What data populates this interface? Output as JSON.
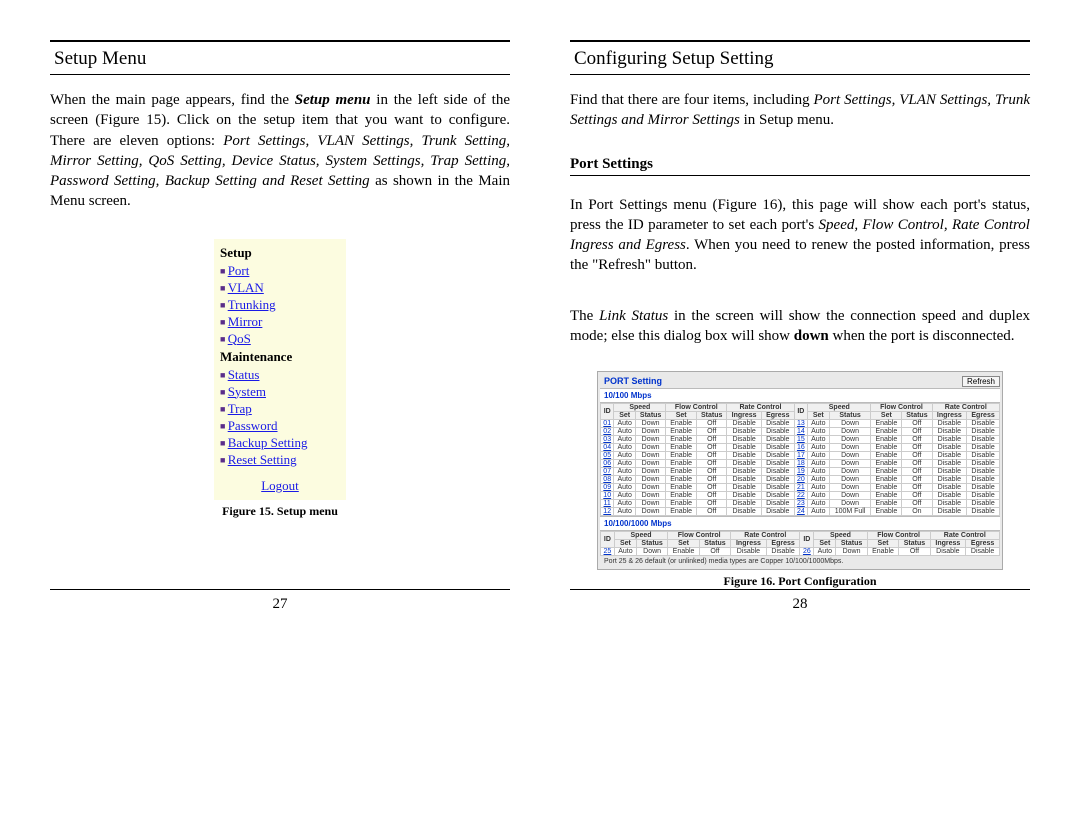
{
  "left": {
    "heading": "Setup Menu",
    "para1_a": "When the main page appears, find the ",
    "para1_b": "Setup menu",
    "para1_c": " in the left side of the screen (Figure 15). Click on the setup item that you want to configure. There are eleven options: ",
    "para1_d": "Port Settings, VLAN Settings, Trunk Setting, Mirror Setting, QoS Setting, Device Status, System Settings, Trap Setting, Password Setting, Backup Setting and Reset Setting",
    "para1_e": " as shown in the Main Menu screen.",
    "menu": {
      "setup": "Setup",
      "items1": [
        "Port",
        "VLAN",
        "Trunking",
        "Mirror",
        "QoS"
      ],
      "maintenance": "Maintenance",
      "items2": [
        "Status",
        "System",
        "Trap",
        "Password",
        "Backup Setting",
        "Reset Setting"
      ],
      "logout": "Logout"
    },
    "caption": "Figure 15. Setup menu",
    "page": "27"
  },
  "right": {
    "heading": "Configuring Setup Setting",
    "para1_a": "Find that there are four items, including ",
    "para1_b": "Port Settings, VLAN Settings, Trunk Settings and Mirror Settings",
    "para1_c": " in Setup menu.",
    "subhead": "Port Settings",
    "para2_a": "In Port Settings menu (Figure 16), this page will show each port's status, press the ID parameter to set each port's ",
    "para2_b": "Speed, Flow Control, Rate Control Ingress and Egress",
    "para2_c": ". When you need to renew the posted information, press the \"Refresh\" button.",
    "para3_a": "The ",
    "para3_b": "Link Status",
    "para3_c": " in the screen will show the connection speed and duplex mode; else this dialog box will show ",
    "para3_d": "down",
    "para3_e": " when the port is disconnected.",
    "port": {
      "title": "PORT Setting",
      "refresh": "Refresh",
      "section1": "10/100 Mbps",
      "section2": "10/100/1000 Mbps",
      "footnote": "Port 25 & 26 default (or unlinked) media types are Copper 10/100/1000Mbps.",
      "headers": {
        "id": "ID",
        "speed": "Speed",
        "set": "Set",
        "status": "Status",
        "flow": "Flow Control",
        "rate": "Rate Control",
        "ingress": "Ingress",
        "egress": "Egress"
      }
    },
    "caption": "Figure 16. Port Configuration",
    "page": "28"
  },
  "chart_data": {
    "type": "table",
    "title": "PORT Setting",
    "sections": [
      {
        "label": "10/100 Mbps",
        "columns": [
          "ID",
          "Speed Set",
          "Speed Status",
          "Flow Set",
          "Flow Status",
          "Rate Ingress",
          "Rate Egress",
          "ID",
          "Speed Set",
          "Speed Status",
          "Flow Set",
          "Flow Status",
          "Rate Ingress",
          "Rate Egress"
        ],
        "rows": [
          [
            "01",
            "Auto",
            "Down",
            "Enable",
            "Off",
            "Disable",
            "Disable",
            "13",
            "Auto",
            "Down",
            "Enable",
            "Off",
            "Disable",
            "Disable"
          ],
          [
            "02",
            "Auto",
            "Down",
            "Enable",
            "Off",
            "Disable",
            "Disable",
            "14",
            "Auto",
            "Down",
            "Enable",
            "Off",
            "Disable",
            "Disable"
          ],
          [
            "03",
            "Auto",
            "Down",
            "Enable",
            "Off",
            "Disable",
            "Disable",
            "15",
            "Auto",
            "Down",
            "Enable",
            "Off",
            "Disable",
            "Disable"
          ],
          [
            "04",
            "Auto",
            "Down",
            "Enable",
            "Off",
            "Disable",
            "Disable",
            "16",
            "Auto",
            "Down",
            "Enable",
            "Off",
            "Disable",
            "Disable"
          ],
          [
            "05",
            "Auto",
            "Down",
            "Enable",
            "Off",
            "Disable",
            "Disable",
            "17",
            "Auto",
            "Down",
            "Enable",
            "Off",
            "Disable",
            "Disable"
          ],
          [
            "06",
            "Auto",
            "Down",
            "Enable",
            "Off",
            "Disable",
            "Disable",
            "18",
            "Auto",
            "Down",
            "Enable",
            "Off",
            "Disable",
            "Disable"
          ],
          [
            "07",
            "Auto",
            "Down",
            "Enable",
            "Off",
            "Disable",
            "Disable",
            "19",
            "Auto",
            "Down",
            "Enable",
            "Off",
            "Disable",
            "Disable"
          ],
          [
            "08",
            "Auto",
            "Down",
            "Enable",
            "Off",
            "Disable",
            "Disable",
            "20",
            "Auto",
            "Down",
            "Enable",
            "Off",
            "Disable",
            "Disable"
          ],
          [
            "09",
            "Auto",
            "Down",
            "Enable",
            "Off",
            "Disable",
            "Disable",
            "21",
            "Auto",
            "Down",
            "Enable",
            "Off",
            "Disable",
            "Disable"
          ],
          [
            "10",
            "Auto",
            "Down",
            "Enable",
            "Off",
            "Disable",
            "Disable",
            "22",
            "Auto",
            "Down",
            "Enable",
            "Off",
            "Disable",
            "Disable"
          ],
          [
            "11",
            "Auto",
            "Down",
            "Enable",
            "Off",
            "Disable",
            "Disable",
            "23",
            "Auto",
            "Down",
            "Enable",
            "Off",
            "Disable",
            "Disable"
          ],
          [
            "12",
            "Auto",
            "Down",
            "Enable",
            "Off",
            "Disable",
            "Disable",
            "24",
            "Auto",
            "100M Full",
            "Enable",
            "On",
            "Disable",
            "Disable"
          ]
        ]
      },
      {
        "label": "10/100/1000 Mbps",
        "columns": [
          "ID",
          "Speed Set",
          "Speed Status",
          "Flow Set",
          "Flow Status",
          "Rate Ingress",
          "Rate Egress",
          "ID",
          "Speed Set",
          "Speed Status",
          "Flow Set",
          "Flow Status",
          "Rate Ingress",
          "Rate Egress"
        ],
        "rows": [
          [
            "25",
            "Auto",
            "Down",
            "Enable",
            "Off",
            "Disable",
            "Disable",
            "26",
            "Auto",
            "Down",
            "Enable",
            "Off",
            "Disable",
            "Disable"
          ]
        ]
      }
    ]
  }
}
